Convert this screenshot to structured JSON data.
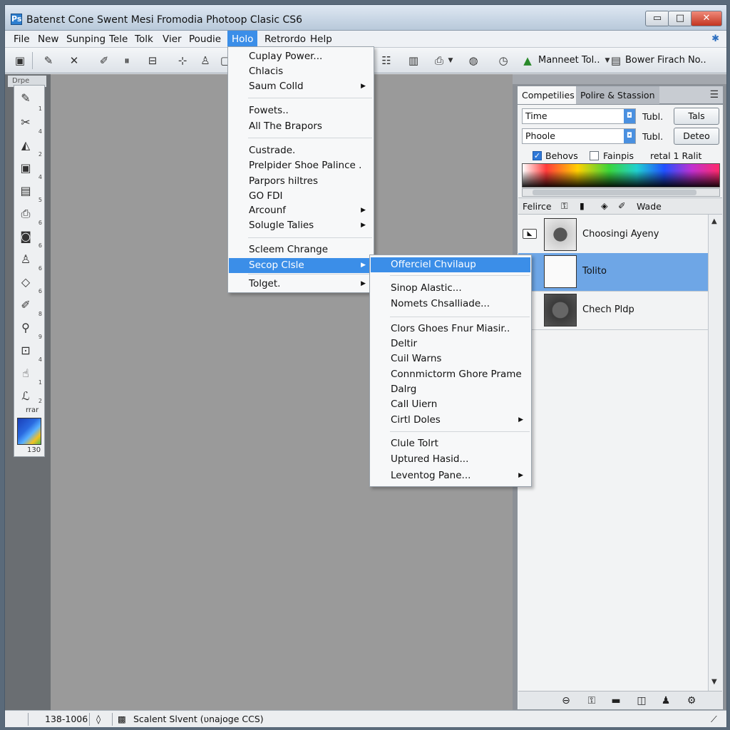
{
  "window": {
    "title": "Batenɛt Cone Swent Mesi Fromodia Photoop Clasic CS6",
    "app_icon": "Ps",
    "minimize_glyph": "▭",
    "maximize_glyph": "□",
    "close_glyph": "✕"
  },
  "menubar": {
    "items": [
      "File",
      "New",
      "Sunping",
      "Tele",
      "Tolk",
      "Viеr",
      "Poudie",
      "Holo",
      "Retrordo",
      "Help"
    ],
    "active": "Holo"
  },
  "optionsbar": {
    "label_1": "Manneet Tol..",
    "label_2": "Bower Firach No.."
  },
  "toolbox": {
    "header": "Drpe",
    "tools": [
      {
        "icon": "brush-icon",
        "glyph": "✎",
        "sub": "1"
      },
      {
        "icon": "cut-icon",
        "glyph": "✂",
        "sub": "4"
      },
      {
        "icon": "gradient-icon",
        "glyph": "◭",
        "sub": "2"
      },
      {
        "icon": "frame-icon",
        "glyph": "▣",
        "sub": "4"
      },
      {
        "icon": "marquee-icon",
        "glyph": "▤",
        "sub": "5"
      },
      {
        "icon": "print-icon",
        "glyph": "⎙",
        "sub": "6"
      },
      {
        "icon": "mask-icon",
        "glyph": "◙",
        "sub": "6"
      },
      {
        "icon": "stamp-icon",
        "glyph": "♙",
        "sub": "6"
      },
      {
        "icon": "shape-icon",
        "glyph": "◇",
        "sub": "6"
      },
      {
        "icon": "pen-icon",
        "glyph": "✐",
        "sub": "8"
      },
      {
        "icon": "eyedropper-icon",
        "glyph": "⚲",
        "sub": "9"
      },
      {
        "icon": "note-icon",
        "glyph": "⊡",
        "sub": "4"
      },
      {
        "icon": "hand-icon",
        "glyph": "☝",
        "sub": "1"
      },
      {
        "icon": "lasso-icon",
        "glyph": "ℒ",
        "sub": "2"
      }
    ],
    "text_below": "rrar",
    "zoom_value": "130"
  },
  "hole_menu": {
    "items": [
      {
        "label": "Cuplay Power...",
        "arrow": false,
        "sep_after": false
      },
      {
        "label": "Chlacis",
        "arrow": false,
        "sep_after": false
      },
      {
        "label": "Saum Colld",
        "arrow": true,
        "sep_after": true
      },
      {
        "label": "Fowets..",
        "arrow": false,
        "sep_after": false
      },
      {
        "label": "All The Brapors",
        "arrow": false,
        "sep_after": true
      },
      {
        "label": "Custrade.",
        "arrow": false,
        "sep_after": false
      },
      {
        "label": "Prelpider Shoe Palince .",
        "arrow": false,
        "sep_after": false
      },
      {
        "label": "Parpors hiltres",
        "arrow": false,
        "sep_after": false
      },
      {
        "label": "GO FDI",
        "arrow": false,
        "sep_after": false
      },
      {
        "label": "Arcounf",
        "arrow": true,
        "sep_after": false
      },
      {
        "label": "Solugle Talies",
        "arrow": true,
        "sep_after": true
      },
      {
        "label": "Scleem Chrange",
        "arrow": false,
        "sep_after": false
      },
      {
        "label": "Secop Clsle",
        "arrow": true,
        "sep_after": true,
        "highlight": true
      },
      {
        "label": "Tolget.",
        "arrow": true,
        "sep_after": false
      }
    ]
  },
  "sub_menu": {
    "items": [
      {
        "label": "Offerciel Chvilaup",
        "arrow": false,
        "highlight": true
      },
      {
        "label": "Sinop Alastic...",
        "arrow": false
      },
      {
        "label": "Nomets Chsalliade...",
        "arrow": false
      },
      {
        "label": "Clors Ghoes Fnur Miasir..",
        "arrow": false
      },
      {
        "label": "Deltir",
        "arrow": false
      },
      {
        "label": "Cuil Warns",
        "arrow": false
      },
      {
        "label": "Connmictorm Ghore Prame",
        "arrow": false
      },
      {
        "label": "Dalrg",
        "arrow": false
      },
      {
        "label": "Call Uiern",
        "arrow": false
      },
      {
        "label": "Cirtl Doles",
        "arrow": true
      },
      {
        "label": "Clule Tolrt",
        "arrow": false
      },
      {
        "label": "Uptured Hasid...",
        "arrow": false
      },
      {
        "label": "Leventog Pane...",
        "arrow": true
      }
    ]
  },
  "right_panel": {
    "tabs": [
      "Competilies",
      "Polire & Stassion"
    ],
    "row1": {
      "field": "Time",
      "label": "Tubl.",
      "button": "Tals"
    },
    "row2": {
      "field": "Phoole",
      "label": "Tubl.",
      "button": "Deteo"
    },
    "checkbox_1": {
      "label": "Behovs",
      "checked": true
    },
    "checkbox_2": {
      "label": "Fainpis",
      "checked": false
    },
    "extra_label": "retal 1 Ralit",
    "layers_header": {
      "label": "Felirce",
      "wade": "Wade"
    },
    "layers": [
      {
        "name": "Choosingi Ayeny",
        "selected": false
      },
      {
        "name": "Tolito",
        "selected": true
      },
      {
        "name": "Chech Pldp",
        "selected": false
      }
    ]
  },
  "statusbar": {
    "zoom": "138-1006",
    "doc": "Scalent Slvent (ʋnajoge CCS)"
  },
  "colors": {
    "accent": "#3b8ee8",
    "selected_layer": "#6ea6e6",
    "canvas": "#9a9a9a"
  }
}
